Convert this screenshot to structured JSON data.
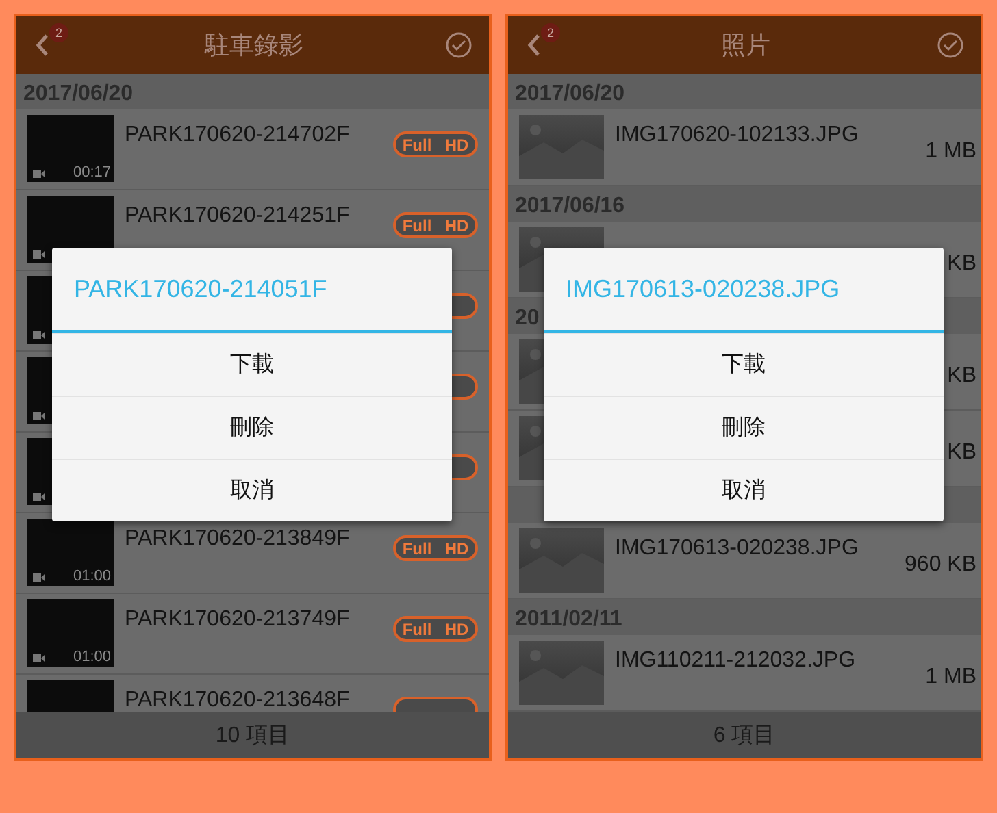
{
  "screens": [
    {
      "title": "駐車錄影",
      "back_badge": "2",
      "footer": "10 項目",
      "sections": [
        {
          "date": "2017/06/20",
          "items": [
            {
              "kind": "video",
              "camera": true,
              "name": "PARK170620-214702F",
              "duration": "00:17",
              "badge": [
                "Full",
                "HD"
              ]
            },
            {
              "kind": "video",
              "camera": true,
              "name": "PARK170620-214251F",
              "badge": [
                "Full",
                "HD"
              ]
            },
            {
              "kind": "video",
              "camera": true
            },
            {
              "kind": "video",
              "camera": true
            },
            {
              "kind": "video",
              "camera": true
            },
            {
              "kind": "video",
              "camera": true,
              "name": "PARK170620-213849F",
              "duration": "01:00",
              "badge": [
                "Full",
                "HD"
              ]
            },
            {
              "kind": "video",
              "camera": true,
              "name": "PARK170620-213749F",
              "duration": "01:00",
              "badge": [
                "Full",
                "HD"
              ]
            },
            {
              "kind": "video",
              "name": "PARK170620-213648F"
            }
          ]
        }
      ],
      "dialog": {
        "title": "PARK170620-214051F",
        "actions": [
          "下載",
          "刪除",
          "取消"
        ]
      }
    },
    {
      "title": "照片",
      "back_badge": "2",
      "footer": "6 項目",
      "sections": [
        {
          "date": "2017/06/20",
          "items": [
            {
              "kind": "photo",
              "name": "IMG170620-102133.JPG",
              "size": "1 MB"
            }
          ]
        },
        {
          "date": "2017/06/16",
          "items": [
            {
              "kind": "photo",
              "size": "KB"
            }
          ]
        },
        {
          "date": "20",
          "items": [
            {
              "kind": "photo",
              "size": "KB"
            },
            {
              "kind": "photo",
              "size": "KB"
            }
          ]
        },
        {
          "items": [
            {
              "kind": "photo",
              "name": "IMG170613-020238.JPG",
              "size": "960 KB"
            }
          ]
        },
        {
          "date": "2011/02/11",
          "items": [
            {
              "kind": "photo",
              "name": "IMG110211-212032.JPG",
              "size": "1 MB"
            }
          ]
        }
      ],
      "dialog": {
        "title": "IMG170613-020238.JPG",
        "actions": [
          "下載",
          "刪除",
          "取消"
        ]
      }
    }
  ]
}
